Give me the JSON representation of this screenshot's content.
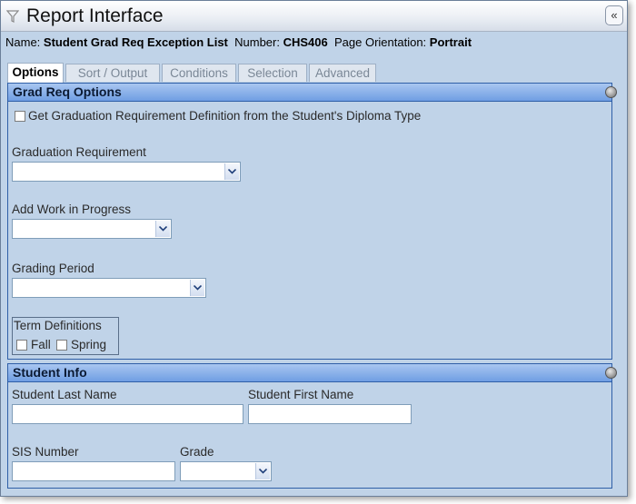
{
  "window": {
    "title": "Report Interface",
    "collapse_glyph": "«",
    "title_icon": "filter-funnel-icon"
  },
  "info": {
    "name_label": "Name:",
    "name_value": "Student Grad Req Exception List",
    "number_label": "Number:",
    "number_value": "CHS406",
    "orientation_label": "Page Orientation:",
    "orientation_value": "Portrait"
  },
  "tabs": [
    "Options",
    "Sort / Output",
    "Conditions",
    "Selection",
    "Advanced"
  ],
  "grad_req": {
    "title": "Grad Req Options",
    "diploma_checkbox_label": "Get Graduation Requirement Definition from the Student's Diploma Type",
    "graduation_requirement_label": "Graduation Requirement",
    "graduation_requirement_value": "",
    "work_in_progress_label": "Add Work in Progress",
    "work_in_progress_value": "",
    "grading_period_label": "Grading Period",
    "grading_period_value": "",
    "term_definitions_label": "Term Definitions",
    "fall_label": "Fall",
    "spring_label": "Spring"
  },
  "student_info": {
    "title": "Student Info",
    "last_name_label": "Student Last Name",
    "last_name_value": "",
    "first_name_label": "Student First Name",
    "first_name_value": "",
    "sis_number_label": "SIS Number",
    "sis_number_value": "",
    "grade_label": "Grade",
    "grade_value": ""
  },
  "colors": {
    "window_bg": "#c0d3e8",
    "panel_header": "#6f9ee3",
    "border": "#2f5fa7"
  }
}
